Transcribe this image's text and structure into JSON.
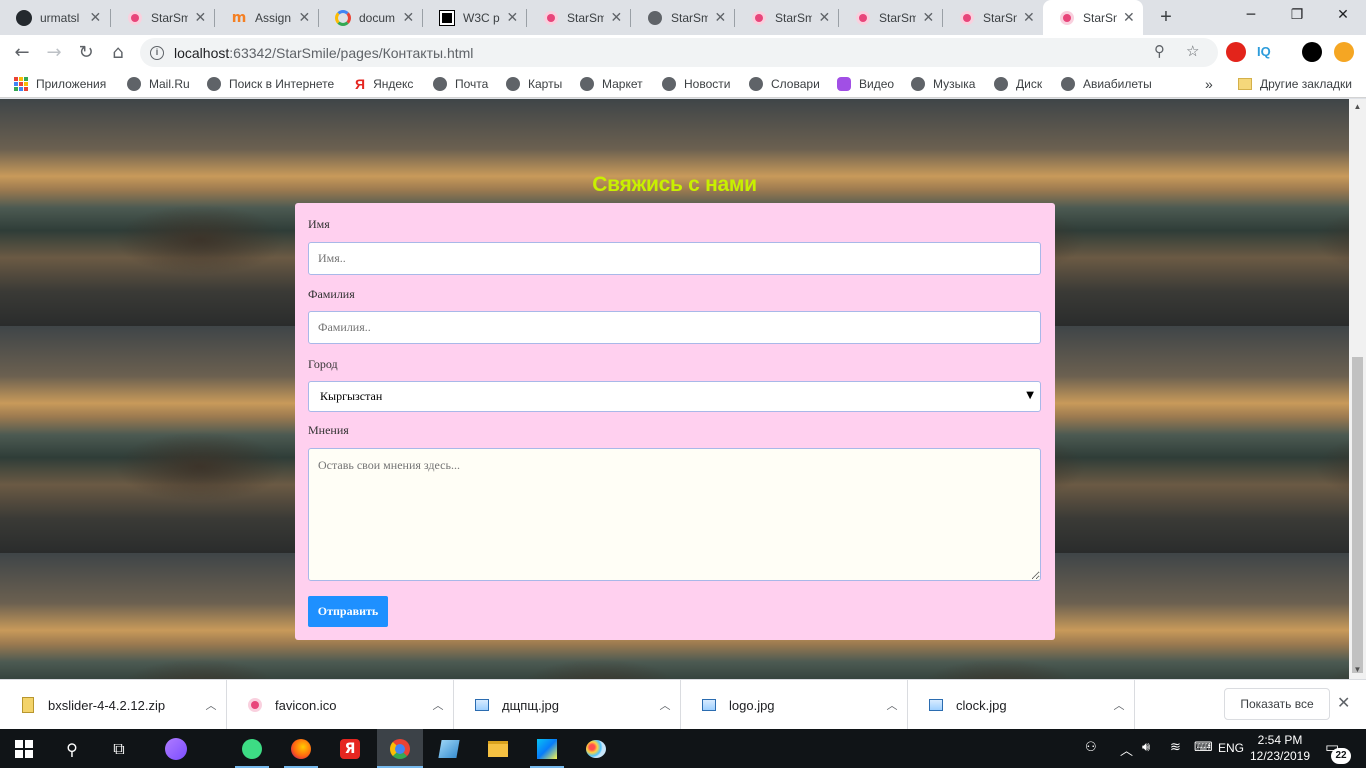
{
  "tabs": [
    {
      "title": "urmatsl",
      "favicon": "github-icon"
    },
    {
      "title": "StarSm",
      "favicon": "site-favicon"
    },
    {
      "title": "Assign",
      "favicon": "moodle-icon"
    },
    {
      "title": "docum",
      "favicon": "google-icon"
    },
    {
      "title": "W3C p",
      "favicon": "w3c-icon"
    },
    {
      "title": "StarSm",
      "favicon": "site-favicon"
    },
    {
      "title": "StarSm",
      "favicon": "globe-icon"
    },
    {
      "title": "StarSm",
      "favicon": "site-favicon"
    },
    {
      "title": "StarSm",
      "favicon": "site-favicon"
    },
    {
      "title": "StarSm",
      "favicon": "site-favicon"
    },
    {
      "title": "StarSm",
      "favicon": "site-favicon",
      "active": true
    }
  ],
  "toolbar": {
    "url_host": "localhost",
    "url_rest": ":63342/StarSmile/pages/Контакты.html"
  },
  "bookmarks": {
    "items": [
      "Приложения",
      "Mail.Ru",
      "Поиск в Интернете",
      "Яндекс",
      "Почта",
      "Карты",
      "Маркет",
      "Новости",
      "Словари",
      "Видео",
      "Музыка",
      "Диск",
      "Авиабилеты"
    ],
    "more": "»",
    "other": "Другие закладки"
  },
  "page": {
    "heading": "Свяжись с нами",
    "form": {
      "first_name_label": "Имя",
      "first_name_placeholder": "Имя..",
      "last_name_label": "Фамилия",
      "last_name_placeholder": "Фамилия..",
      "city_label": "Город",
      "city_value": "Кыргызстан",
      "opinion_label": "Мнения",
      "opinion_placeholder": "Оставь свои мнения здесь...",
      "submit_label": "Отправить"
    },
    "colors": {
      "heading": "#c8f000",
      "card": "#ffd0ef",
      "button": "#1e90ff"
    }
  },
  "downloads": {
    "items": [
      "bxslider-4-4.2.12.zip",
      "favicon.ico",
      "дщпщ.jpg",
      "logo.jpg",
      "clock.jpg"
    ],
    "show_all": "Показать все"
  },
  "taskbar": {
    "time": "2:54 PM",
    "date": "12/23/2019",
    "lang": "ENG",
    "notifications": "22"
  }
}
